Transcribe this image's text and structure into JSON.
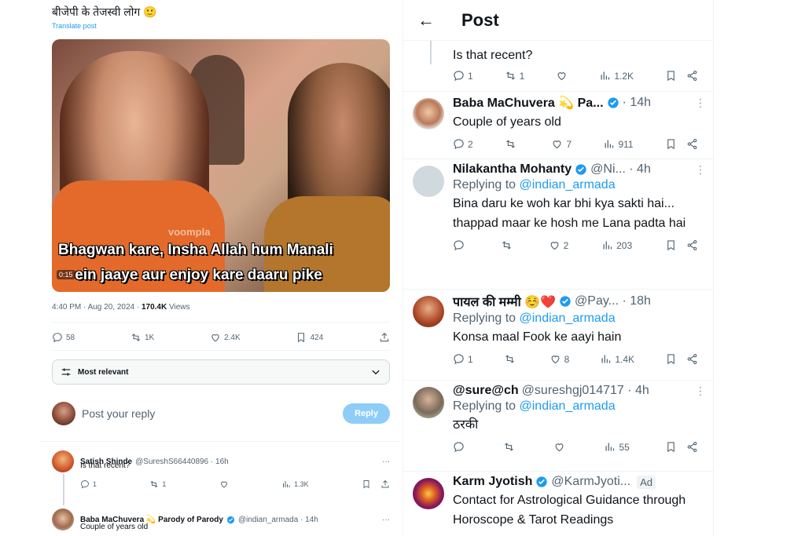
{
  "left": {
    "tweet_text": "बीजेपी के तेजस्वी लोग 🙂",
    "translate_label": "Translate post",
    "media": {
      "caption_line1": "Bhagwan kare, Insha Allah hum Manali",
      "caption_line2": "ein jaaye aur enjoy kare daaru pike",
      "time_badge": "0:15",
      "watermark": "voompla"
    },
    "meta": {
      "time": "4:40 PM · Aug 20, 2024 · ",
      "views": "170.4K",
      "views_label": " Views"
    },
    "actions": {
      "replies": "58",
      "reposts": "1K",
      "likes": "2.4K",
      "bookmarks": "424"
    },
    "sort_label": "Most relevant",
    "reply_placeholder": "Post your reply",
    "reply_button": "Reply",
    "replies": [
      {
        "name": "Satish Shinde",
        "handle": "@SureshS66440896 · 16h",
        "text": "Is that recent?",
        "replies": "1",
        "reposts": "1",
        "views": "1.3K"
      },
      {
        "name": "Baba MaChuvera 💫 Parody of Parody",
        "handle": "@indian_armada · 14h",
        "text": "Couple of years old"
      }
    ]
  },
  "right": {
    "header": {
      "title": "Post"
    },
    "top_fragment": {
      "text": "Is that recent?",
      "replies": "1",
      "reposts": "1",
      "views": "1.2K"
    },
    "posts": [
      {
        "name": "Baba MaChuvera 💫 Pa...",
        "handle": "· 14h",
        "text": "Couple of years old",
        "replies": "2",
        "reposts": "",
        "likes": "7",
        "views": "911",
        "verified": true
      },
      {
        "name": "Nilakantha Mohanty",
        "handle": "@Ni... · 4h",
        "replying_prefix": "Replying to ",
        "mention": "@indian_armada",
        "text": "Bina daru ke woh kar bhi kya sakti hai... thappad maar ke hosh me Lana padta hai",
        "replies": "",
        "reposts": "",
        "likes": "2",
        "views": "203",
        "verified": true
      },
      {
        "name": "पायल की मम्मी ☺️❤️",
        "handle": "@Pay... · 18h",
        "replying_prefix": "Replying to ",
        "mention": "@indian_armada",
        "text": "Konsa maal Fook ke aayi hain",
        "replies": "1",
        "reposts": "",
        "likes": "8",
        "views": "1.4K",
        "verified": true
      },
      {
        "name": "@sure@ch",
        "handle": "@sureshgj014717 · 4h",
        "replying_prefix": "Replying to ",
        "mention": "@indian_armada",
        "text": "ठरकी",
        "replies": "",
        "reposts": "",
        "likes": "",
        "views": "55",
        "verified": false
      },
      {
        "name": "Karm Jyotish",
        "handle": "@KarmJyoti...",
        "ad_label": "Ad",
        "text": "Contact for Astrological Guidance through Horoscope & Tarot Readings",
        "verified": true
      }
    ]
  },
  "colors": {
    "accent": "#1d9bf0",
    "text": "#0f1419",
    "muted": "#536471",
    "border": "#eff3f4",
    "reply_button_disabled": "#8ecdf8"
  }
}
